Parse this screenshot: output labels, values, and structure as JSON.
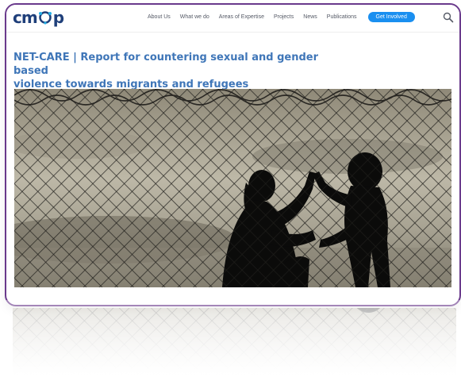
{
  "header": {
    "logo_text_left": "cm",
    "logo_text_right": "p",
    "nav": [
      {
        "label": "About Us"
      },
      {
        "label": "What we do"
      },
      {
        "label": "Areas of Expertise"
      },
      {
        "label": "Projects"
      },
      {
        "label": "News"
      },
      {
        "label": "Publications"
      }
    ],
    "cta_label": "Get Involved",
    "search_icon": "search-icon"
  },
  "article": {
    "title_line1": "NET-CARE | Report for countering sexual and gender based",
    "title_line2": "violence towards migrants and refugees"
  },
  "hero_image": {
    "subject": "silhouette of a woman and a child high-fiving behind a chain-link fence"
  },
  "colors": {
    "frame_border": "#6a3a8c",
    "title": "#3f76b8",
    "cta_bg": "#1a8ff0",
    "logo": "#1f3f7a"
  }
}
